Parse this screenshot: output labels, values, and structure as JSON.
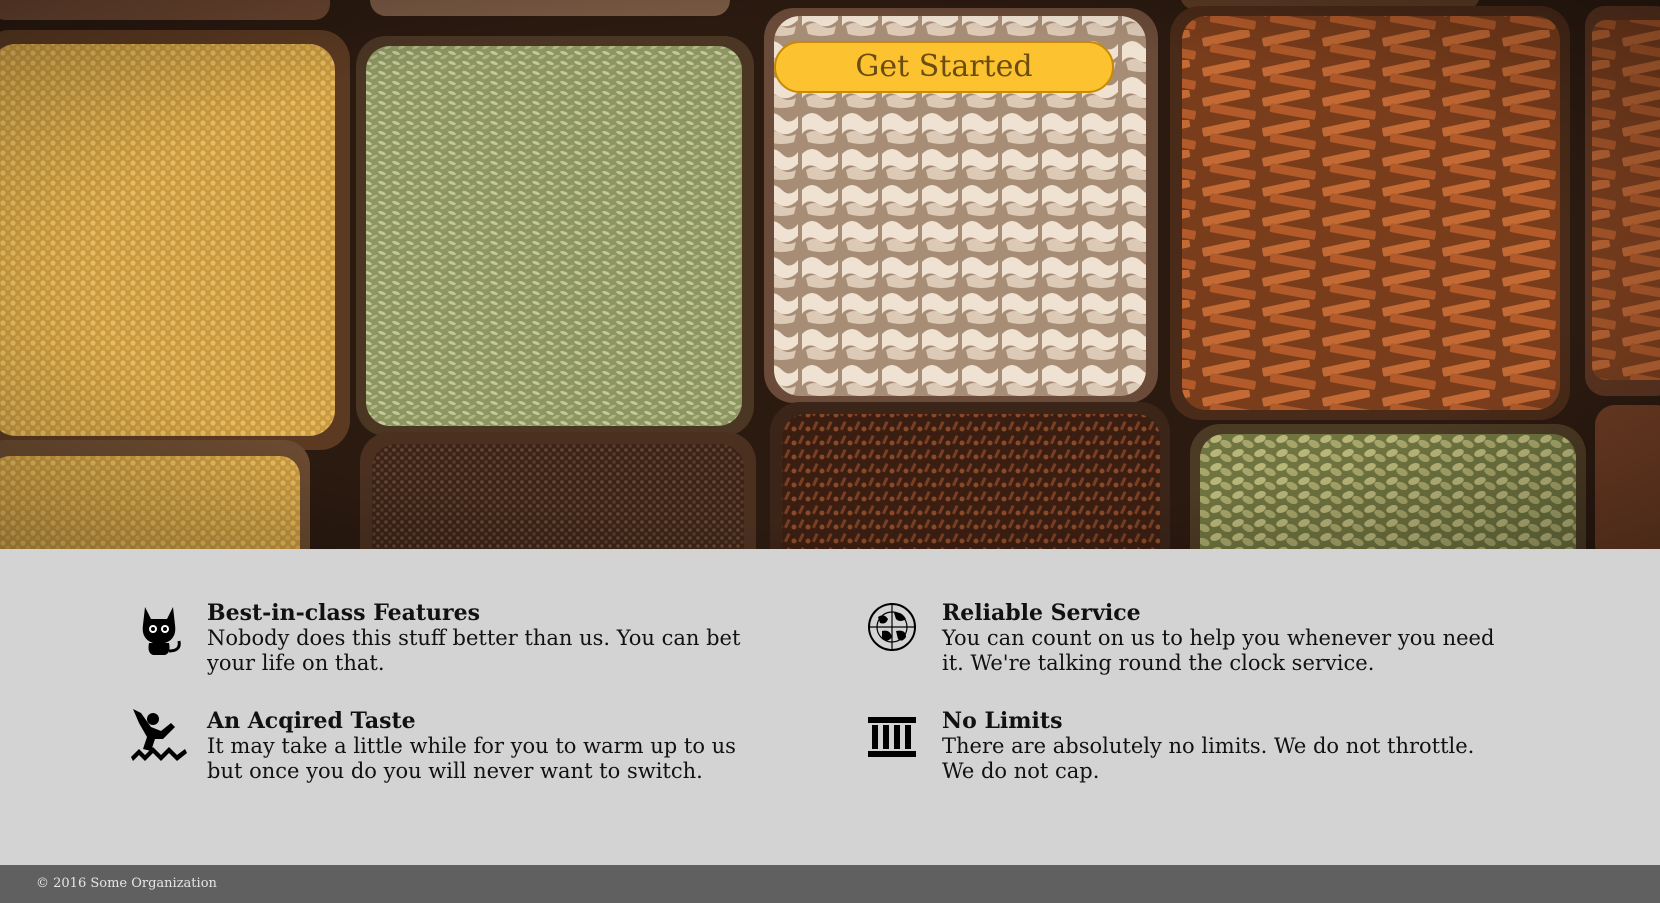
{
  "hero": {
    "cta_label": "Get Started",
    "accent": "#fcc22f"
  },
  "features": [
    {
      "icon": "cat-icon",
      "title": "Best-in-class Features",
      "text": "Nobody does this stuff better than us. You can bet your life on that."
    },
    {
      "icon": "globe-icon",
      "title": "Reliable Service",
      "text": "You can count on us to help you whenever you need it. We're talking round the clock service."
    },
    {
      "icon": "skier-icon",
      "title": "An Acqired Taste",
      "text": "It may take a little while for you to warm up to us but once you do you will never want to switch."
    },
    {
      "icon": "columns-icon",
      "title": "No Limits",
      "text": "There are absolutely no limits. We do not throttle. We do not cap."
    }
  ],
  "footer": {
    "copyright": "© 2016 Some Organization"
  }
}
